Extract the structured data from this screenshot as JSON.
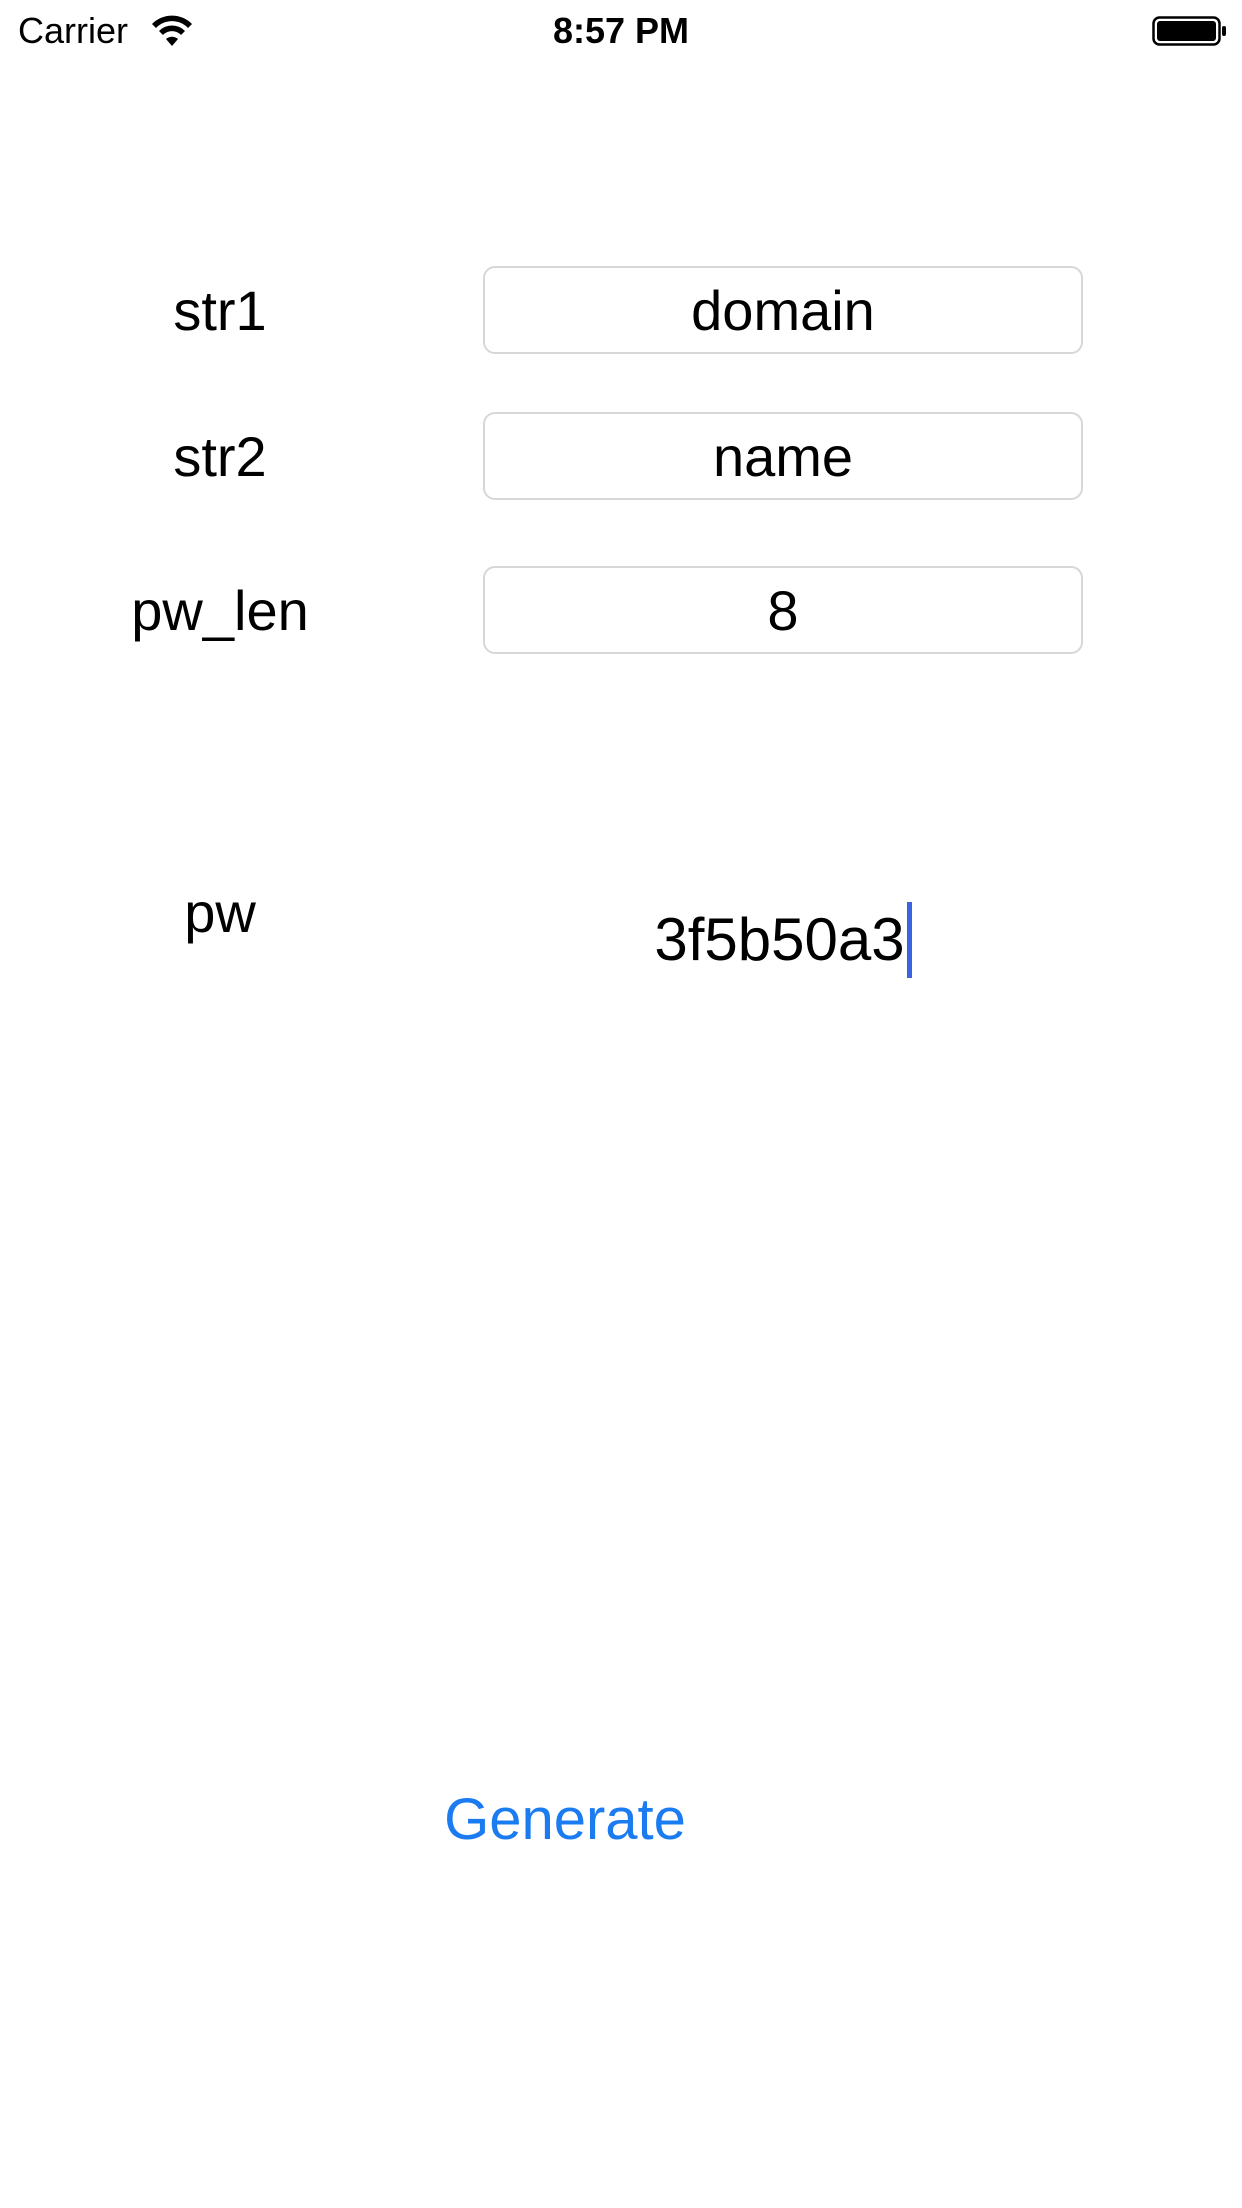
{
  "status_bar": {
    "carrier": "Carrier",
    "time": "8:57 PM",
    "wifi_icon": "wifi-icon",
    "battery_icon": "battery-icon"
  },
  "form": {
    "str1": {
      "label": "str1",
      "value": "domain"
    },
    "str2": {
      "label": "str2",
      "value": "name"
    },
    "pw_len": {
      "label": "pw_len",
      "value": "8"
    }
  },
  "result": {
    "label": "pw",
    "value": "3f5b50a3"
  },
  "actions": {
    "generate_label": "Generate"
  },
  "colors": {
    "accent": "#1a7cf0",
    "caret": "#3b63e0",
    "field_border": "#d7d7d7"
  }
}
